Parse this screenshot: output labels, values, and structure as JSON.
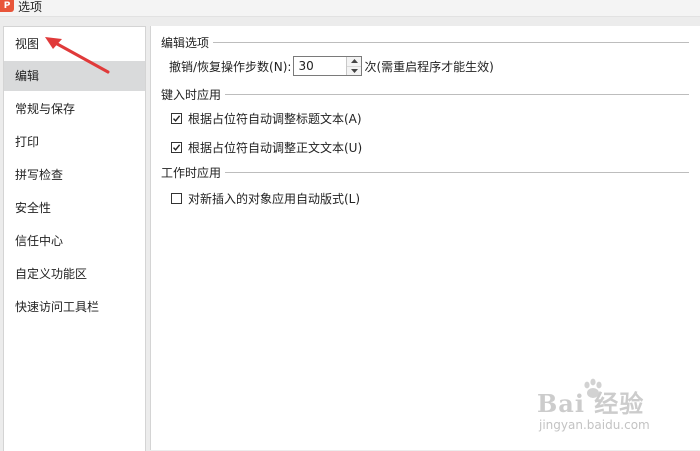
{
  "window": {
    "app_icon_glyph": "P",
    "title": "选项"
  },
  "sidebar": {
    "items": [
      {
        "label": "视图",
        "selected": false
      },
      {
        "label": "编辑",
        "selected": true
      },
      {
        "label": "常规与保存",
        "selected": false
      },
      {
        "label": "打印",
        "selected": false
      },
      {
        "label": "拼写检查",
        "selected": false
      },
      {
        "label": "安全性",
        "selected": false
      },
      {
        "label": "信任中心",
        "selected": false
      },
      {
        "label": "自定义功能区",
        "selected": false
      },
      {
        "label": "快速访问工具栏",
        "selected": false
      }
    ]
  },
  "main": {
    "edit_options": {
      "header": "编辑选项",
      "undo_label": "撤销/恢复操作步数(N):",
      "undo_value": "30",
      "undo_suffix": "次(需重启程序才能生效)"
    },
    "typing": {
      "header": "键入时应用",
      "options": [
        {
          "label": "根据占位符自动调整标题文本(A)",
          "checked": true
        },
        {
          "label": "根据占位符自动调整正文文本(U)",
          "checked": true
        }
      ]
    },
    "working": {
      "header": "工作时应用",
      "options": [
        {
          "label": "对新插入的对象应用自动版式(L)",
          "checked": false
        }
      ]
    }
  },
  "annotation": {
    "arrow_color": "#e03a3a"
  },
  "watermark": {
    "main": "Bai 经验",
    "sub": "jingyan.baidu.com"
  },
  "colors": {
    "selected_bg": "#d9dadb",
    "app_icon": "#e8553a"
  }
}
